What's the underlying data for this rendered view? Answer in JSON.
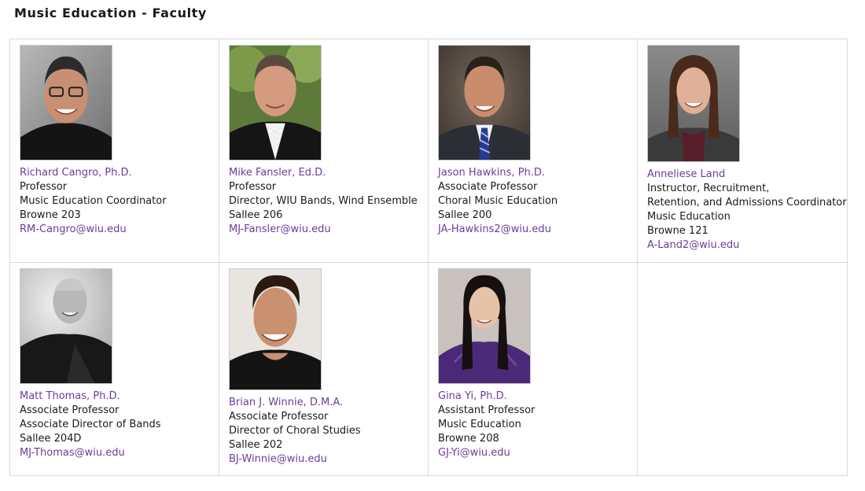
{
  "page": {
    "title": "Music Education - Faculty"
  },
  "faculty": [
    {
      "name": "Richard Cangro, Ph.D.",
      "lines": [
        "Professor",
        "Music Education Coordinator",
        "Browne 203"
      ],
      "email": "RM-Cangro@wiu.edu"
    },
    {
      "name": "Mike Fansler, Ed.D.",
      "lines": [
        "Professor",
        "Director, WIU Bands, Wind Ensemble",
        "Sallee 206"
      ],
      "email": "MJ-Fansler@wiu.edu"
    },
    {
      "name": "Jason Hawkins, Ph.D.",
      "lines": [
        "Associate Professor",
        "Choral Music Education",
        "Sallee 200"
      ],
      "email": "JA-Hawkins2@wiu.edu"
    },
    {
      "name": "Anneliese Land",
      "lines": [
        "Instructor, Recruitment,",
        "Retention, and Admissions Coordinator",
        "Music Education",
        "Browne 121"
      ],
      "email": "A-Land2@wiu.edu"
    },
    {
      "name": "Matt Thomas, Ph.D.",
      "lines": [
        "Associate Professor",
        "Associate Director of Bands",
        "Sallee 204D"
      ],
      "email": "MJ-Thomas@wiu.edu"
    },
    {
      "name": "Brian J. Winnie, D.M.A.",
      "lines": [
        "Associate Professor",
        "Director of Choral Studies",
        "Sallee 202"
      ],
      "email": "BJ-Winnie@wiu.edu"
    },
    {
      "name": "Gina Yi, Ph.D.",
      "lines": [
        "Assistant Professor",
        "Music Education",
        "Browne 208"
      ],
      "email": "GJ-Yi@wiu.edu"
    }
  ],
  "colors": {
    "link": "#6a3d9a",
    "text": "#1a1a1a",
    "border": "#d8d8d8"
  }
}
